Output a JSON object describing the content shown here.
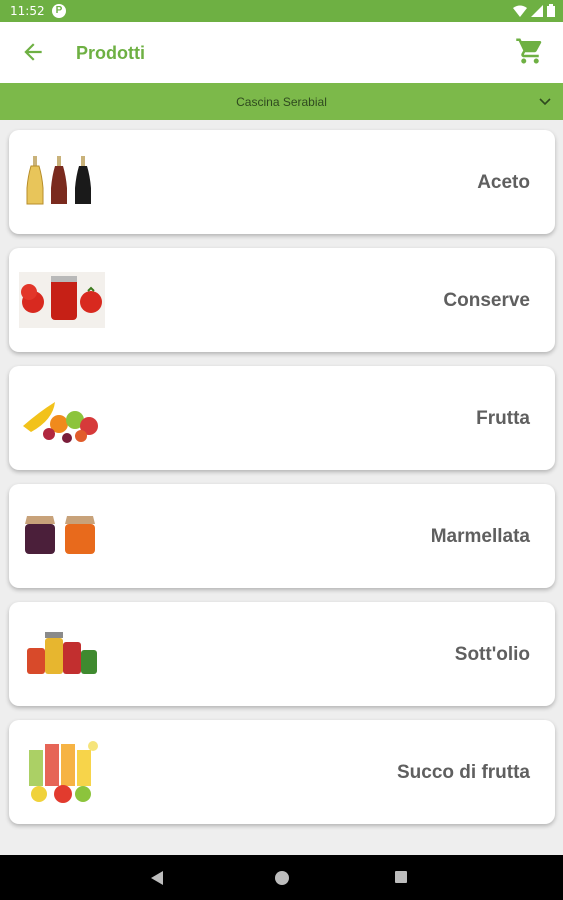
{
  "status_bar": {
    "time": "11:52",
    "notification_icon": "p-circle-icon",
    "right_icons": [
      "wifi-icon",
      "signal-icon",
      "battery-icon"
    ]
  },
  "app_bar": {
    "title": "Prodotti",
    "back_icon": "arrow-back-icon",
    "cart_icon": "shopping-cart-icon"
  },
  "store_selector": {
    "selected": "Cascina Serabial"
  },
  "categories": [
    {
      "label": "Aceto",
      "image": "vinegar-bottles-image"
    },
    {
      "label": "Conserve",
      "image": "tomato-preserves-image"
    },
    {
      "label": "Frutta",
      "image": "fruit-image"
    },
    {
      "label": "Marmellata",
      "image": "jam-jars-image"
    },
    {
      "label": "Sott'olio",
      "image": "preserved-jars-image"
    },
    {
      "label": "Succo di frutta",
      "image": "fruit-juice-image"
    }
  ],
  "colors": {
    "primary_green": "#6eb043",
    "selector_green": "#7cb94a",
    "background": "#eeeeee"
  },
  "nav_bar": [
    "back-icon",
    "home-icon",
    "recents-icon"
  ]
}
